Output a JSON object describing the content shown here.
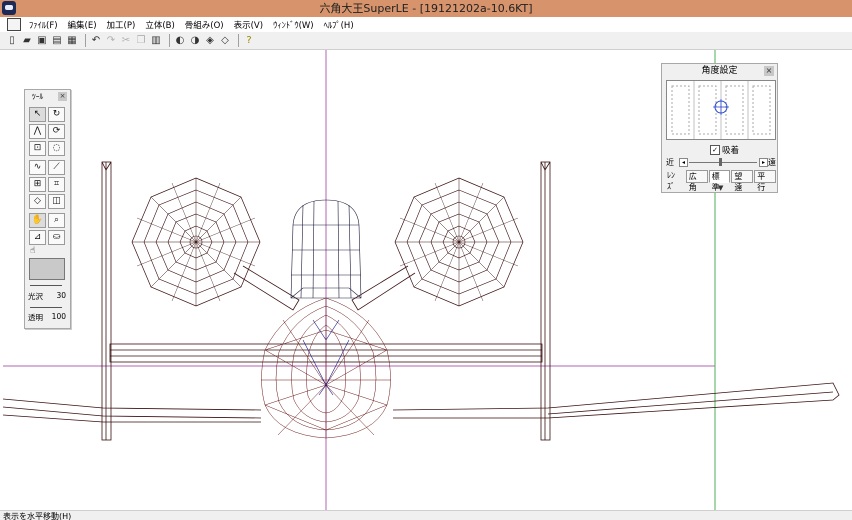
{
  "window": {
    "title": "六角大王SuperLE - [19121202a-10.6KT]"
  },
  "menu": [
    "ﾌｧｲﾙ(F)",
    "編集(E)",
    "加工(P)",
    "立体(B)",
    "骨組み(O)",
    "表示(V)",
    "ｳｨﾝﾄﾞｳ(W)",
    "ﾍﾙﾌﾟ(H)"
  ],
  "toolbar_icons": [
    "new-file-icon",
    "open-file-icon",
    "save-icon",
    "save-all-icon",
    "print-icon",
    "undo-icon",
    "redo-icon",
    "cut-icon",
    "copy-icon",
    "paste-icon",
    "view-front-icon",
    "view-side-icon",
    "view-3d-icon",
    "view-top-icon",
    "help-icon"
  ],
  "tool_palette": {
    "title": "ﾂｰﾙ",
    "close": "×",
    "gloss_label": "光沢",
    "gloss_value": "30",
    "alpha_label": "透明",
    "alpha_value": "100"
  },
  "angle_panel": {
    "title": "角度設定",
    "close": "×",
    "snap_label": "吸着",
    "snap_checked": "✓",
    "near_label": "近",
    "far_label": "遠",
    "tabs": [
      "ﾚﾝｽﾞ",
      "広角",
      "標準",
      "望遠",
      "平行"
    ]
  },
  "status": {
    "text": "表示を水平移動(H)"
  },
  "colors": {
    "titlebar": "#d7936b",
    "axis_vertical": "#b266b2",
    "axis_green": "#4caf50",
    "wire_dark": "#3a1010",
    "wire_red": "#8b1a1a",
    "wire_blue": "#1a1a8b"
  }
}
